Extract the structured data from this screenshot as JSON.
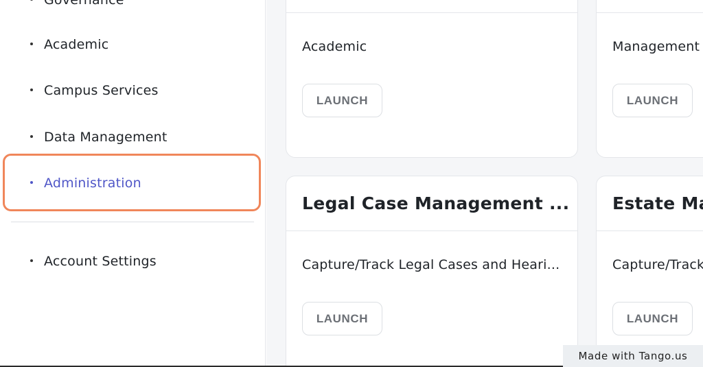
{
  "sidebar": {
    "items": [
      {
        "label": "Governance"
      },
      {
        "label": "Academic"
      },
      {
        "label": "Campus Services"
      },
      {
        "label": "Data Management"
      },
      {
        "label": "Administration",
        "active": true
      },
      {
        "label": "Account Settings"
      }
    ]
  },
  "cards": [
    {
      "title": "",
      "description": "Academic",
      "button": "LAUNCH"
    },
    {
      "title": "",
      "description": "Management",
      "button": "LAUNCH"
    },
    {
      "title": "Legal Case Management ...",
      "description": "Capture/Track Legal Cases and Heari...",
      "button": "LAUNCH"
    },
    {
      "title": "Estate Ma",
      "description": "Capture/Track",
      "button": "LAUNCH"
    }
  ],
  "watermark": "Made with Tango.us",
  "colors": {
    "active_nav": "#4f56c7",
    "highlight_border": "#f0865a",
    "main_background": "#f5f6f8"
  }
}
